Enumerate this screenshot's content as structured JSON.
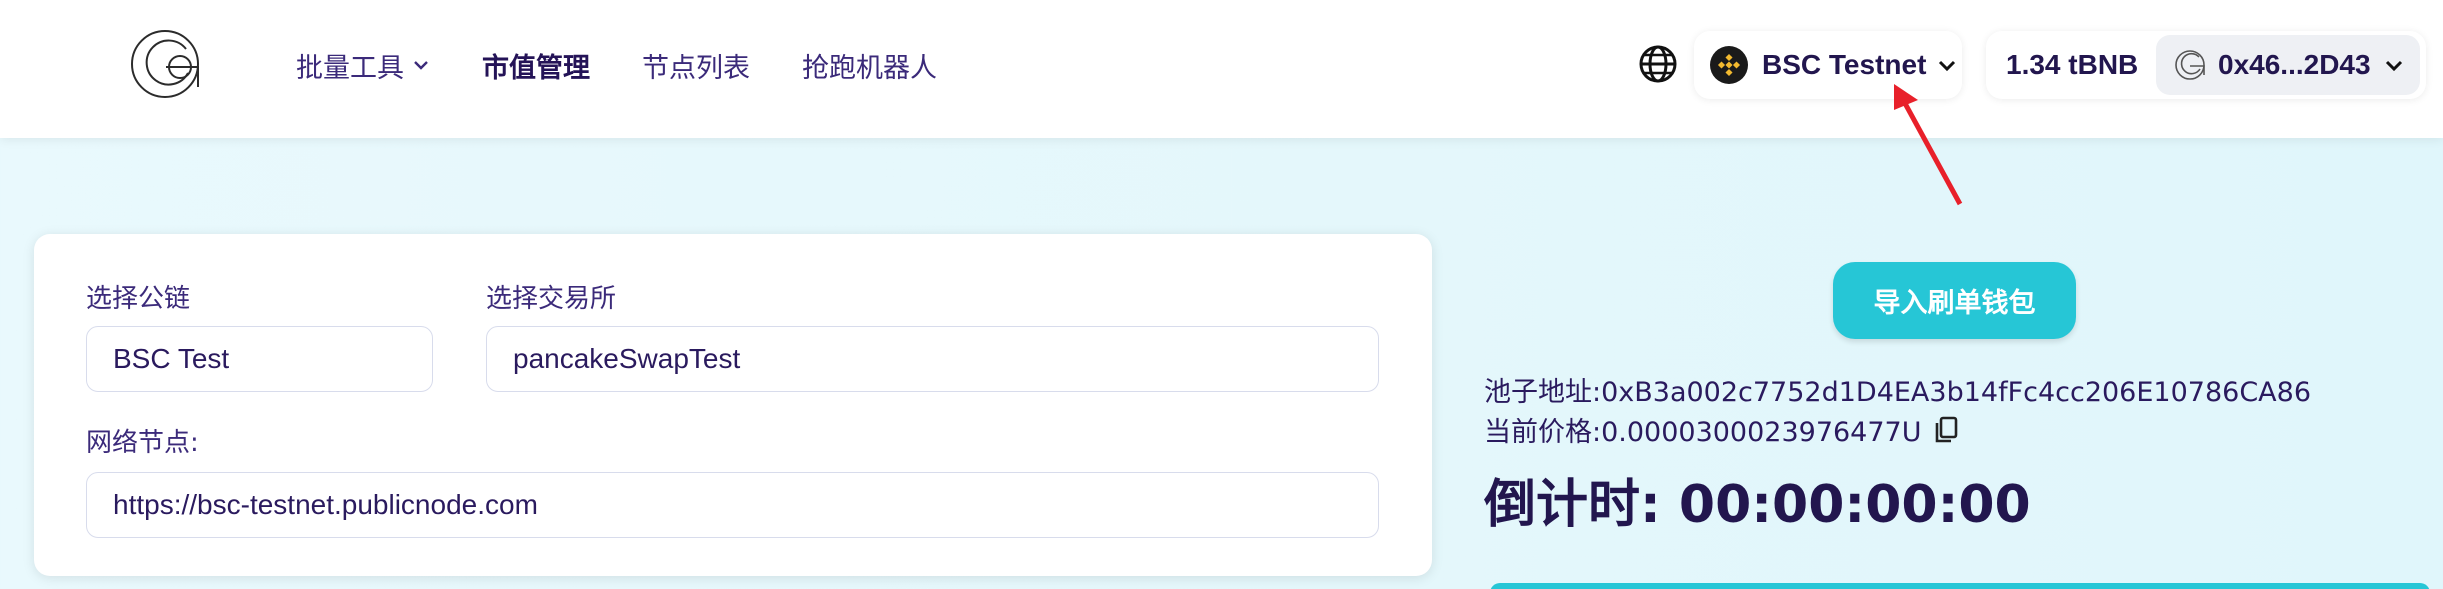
{
  "header": {
    "nav": [
      {
        "label": "批量工具",
        "has_dropdown": true
      },
      {
        "label": "市值管理",
        "active": true
      },
      {
        "label": "节点列表"
      },
      {
        "label": "抢跑机器人"
      }
    ],
    "network": {
      "label": "BSC Testnet",
      "icon": "bnb-icon"
    },
    "balance": "1.34 tBNB",
    "address": "0x46...2D43"
  },
  "form": {
    "chain_label": "选择公链",
    "chain_value": "BSC Test",
    "exchange_label": "选择交易所",
    "exchange_value": "pancakeSwapTest",
    "node_label": "网络节点:",
    "node_value": "https://bsc-testnet.publicnode.com"
  },
  "panel": {
    "import_label": "导入刷单钱包",
    "pool_address": "池子地址:0xB3a002c7752d1D4EA3b14fFc4cc206E10786CA86",
    "price": "当前价格:0.0000300023976477U",
    "countdown": "倒计时: 00:00:00:00"
  },
  "colors": {
    "accent": "#26c6d6",
    "primary_text": "#22164e",
    "annotation_arrow": "#e8202a"
  }
}
